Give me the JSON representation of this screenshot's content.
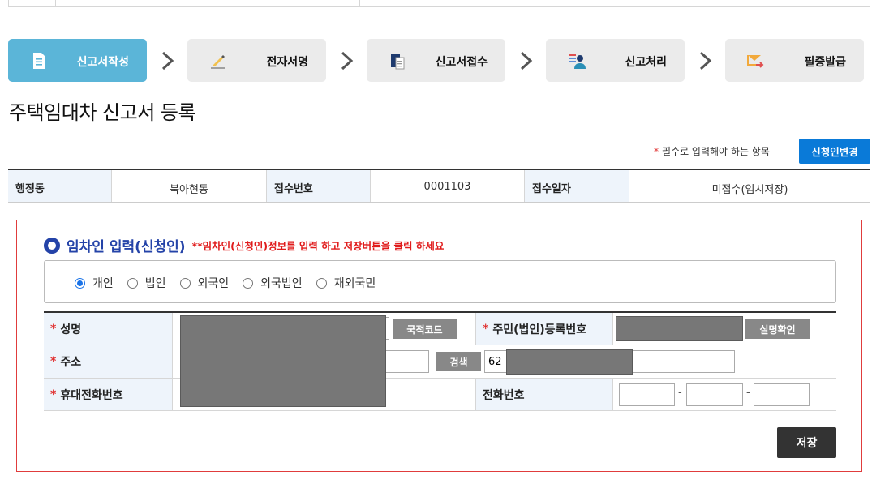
{
  "steps": [
    {
      "label": "신고서작성",
      "icon": "document-icon",
      "active": true
    },
    {
      "label": "전자서명",
      "icon": "pen-sign-icon",
      "active": false
    },
    {
      "label": "신고서접수",
      "icon": "file-receive-icon",
      "active": false
    },
    {
      "label": "신고처리",
      "icon": "clerk-process-icon",
      "active": false
    },
    {
      "label": "필증발급",
      "icon": "certificate-issue-icon",
      "active": false
    }
  ],
  "page": {
    "title": "주택임대차 신고서 등록"
  },
  "required_note": {
    "star": "*",
    "text": "필수로 입력해야 하는 항목"
  },
  "change_applicant_button": "신청인변경",
  "info": {
    "dong_label": "행정동",
    "dong_value": "북아현동",
    "receipt_no_label": "접수번호",
    "receipt_no_value": "0001103",
    "receipt_date_label": "접수일자",
    "receipt_date_value": "미접수(임시저장)"
  },
  "section": {
    "title": "임차인 입력(신청인)",
    "warning": "**임차인(신청인)정보를 입력 하고 저장버튼을 클릭 하세요"
  },
  "person_types": [
    "개인",
    "법인",
    "외국인",
    "외국법인",
    "재외국민"
  ],
  "person_type_selected": "개인",
  "form": {
    "name_label": "성명",
    "country_code_button": "국적코드",
    "reg_no_label": "주민(법인)등록번호",
    "verify_button": "실명확인",
    "address_label": "주소",
    "search_button": "검색",
    "address_prefix_value": "62",
    "mobile_label": "휴대전화번호",
    "phone_label": "전화번호",
    "phone_separator": "-",
    "required_star": "*"
  },
  "save_button": "저장",
  "colors": {
    "active_step": "#5bb5d8",
    "blue_button": "#0a7ad8",
    "section_blue": "#2443a8",
    "warning_red": "#e01b1b",
    "border_red": "#e03c3c"
  }
}
